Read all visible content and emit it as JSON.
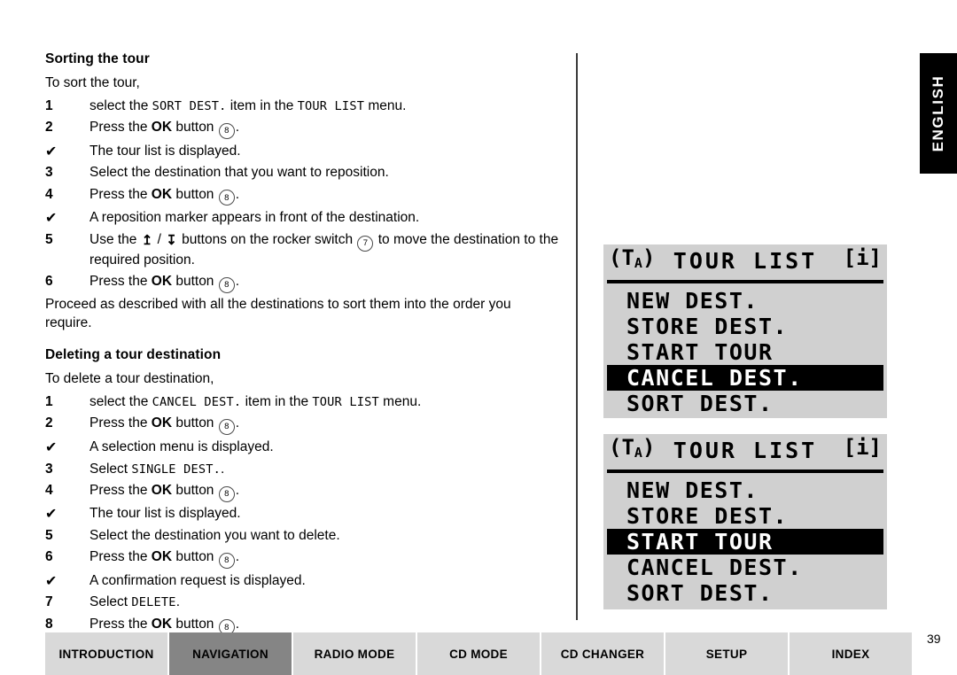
{
  "language_tab": {
    "label": "ENGLISH"
  },
  "page_number": "39",
  "sections": [
    {
      "heading": "Sorting the tour",
      "lead": "To sort the tour,",
      "steps": [
        {
          "marker": "1",
          "type": "number",
          "text_before": "select the ",
          "mono1": "SORT DEST.",
          "text_mid": " item in the ",
          "mono2": "TOUR LIST",
          "text_after": " menu."
        },
        {
          "marker": "2",
          "type": "number",
          "text_before": "Press the ",
          "bold": "OK",
          "text_mid": " button ",
          "circled": "8",
          "text_after": "."
        },
        {
          "marker": "✔",
          "type": "check",
          "text_before": "The tour list is displayed."
        },
        {
          "marker": "3",
          "type": "number",
          "text_before": "Select the destination that you want to reposition."
        },
        {
          "marker": "4",
          "type": "number",
          "text_before": "Press the ",
          "bold": "OK",
          "text_mid": " button ",
          "circled": "8",
          "text_after": "."
        },
        {
          "marker": "✔",
          "type": "check",
          "text_before": "A reposition marker appears in front of the destination."
        },
        {
          "marker": "5",
          "type": "number",
          "text_before": "Use the ",
          "arrow_up": "↥",
          "arrow_sep": " / ",
          "arrow_down": "↧",
          "text_mid": " buttons on the rocker switch ",
          "circled": "7",
          "text_after": " to move the destination to the required position."
        },
        {
          "marker": "6",
          "type": "number",
          "text_before": "Press the ",
          "bold": "OK",
          "text_mid": " button ",
          "circled": "8",
          "text_after": "."
        }
      ],
      "closing": "Proceed as described with all the destinations to sort them into the order you require."
    },
    {
      "heading": "Deleting a tour destination",
      "lead": "To delete a tour destination,",
      "steps": [
        {
          "marker": "1",
          "type": "number",
          "text_before": "select the ",
          "mono1": "CANCEL DEST.",
          "text_mid": " item in the ",
          "mono2": "TOUR LIST",
          "text_after": " menu."
        },
        {
          "marker": "2",
          "type": "number",
          "text_before": "Press the ",
          "bold": "OK",
          "text_mid": " button ",
          "circled": "8",
          "text_after": "."
        },
        {
          "marker": "✔",
          "type": "check",
          "text_before": "A selection menu is displayed."
        },
        {
          "marker": "3",
          "type": "number",
          "text_before": "Select ",
          "mono1": "SINGLE DEST.",
          "text_after": "."
        },
        {
          "marker": "4",
          "type": "number",
          "text_before": "Press the ",
          "bold": "OK",
          "text_mid": " button ",
          "circled": "8",
          "text_after": "."
        },
        {
          "marker": "✔",
          "type": "check",
          "text_before": "The tour list is displayed."
        },
        {
          "marker": "5",
          "type": "number",
          "text_before": "Select the destination you want to delete."
        },
        {
          "marker": "6",
          "type": "number",
          "text_before": "Press the ",
          "bold": "OK",
          "text_mid": " button ",
          "circled": "8",
          "text_after": "."
        },
        {
          "marker": "✔",
          "type": "check",
          "text_before": "A confirmation request is displayed."
        },
        {
          "marker": "7",
          "type": "number",
          "text_before": "Select ",
          "mono1": "DELETE",
          "text_after": "."
        },
        {
          "marker": "8",
          "type": "number",
          "text_before": "Press the ",
          "bold": "OK",
          "text_mid": " button ",
          "circled": "8",
          "text_after": "."
        }
      ]
    }
  ],
  "lcd_displays": [
    {
      "badge_left": "TA",
      "badge_right": "i",
      "title": "TOUR LIST",
      "rows": [
        {
          "label": "NEW DEST.",
          "selected": false
        },
        {
          "label": "STORE DEST.",
          "selected": false
        },
        {
          "label": "START TOUR",
          "selected": false
        },
        {
          "label": "CANCEL DEST.",
          "selected": true
        },
        {
          "label": "SORT DEST.",
          "selected": false
        }
      ]
    },
    {
      "badge_left": "TA",
      "badge_right": "i",
      "title": "TOUR LIST",
      "rows": [
        {
          "label": "NEW DEST.",
          "selected": false
        },
        {
          "label": "STORE DEST.",
          "selected": false
        },
        {
          "label": "START TOUR",
          "selected": true
        },
        {
          "label": "CANCEL DEST.",
          "selected": false
        },
        {
          "label": "SORT DEST.",
          "selected": false
        }
      ]
    }
  ],
  "footer_nav": {
    "tabs": [
      {
        "label": "INTRODUCTION",
        "active": false
      },
      {
        "label": "NAVIGATION",
        "active": true
      },
      {
        "label": "RADIO MODE",
        "active": false
      },
      {
        "label": "CD MODE",
        "active": false
      },
      {
        "label": "CD CHANGER",
        "active": false
      },
      {
        "label": "SETUP",
        "active": false
      },
      {
        "label": "INDEX",
        "active": false
      }
    ]
  },
  "colors": {
    "lcd_background": "#d0d0d0",
    "lcd_highlight": "#000000",
    "nav_tab": "#d9d9d9",
    "nav_tab_active": "#858585",
    "language_tab": "#000000"
  }
}
